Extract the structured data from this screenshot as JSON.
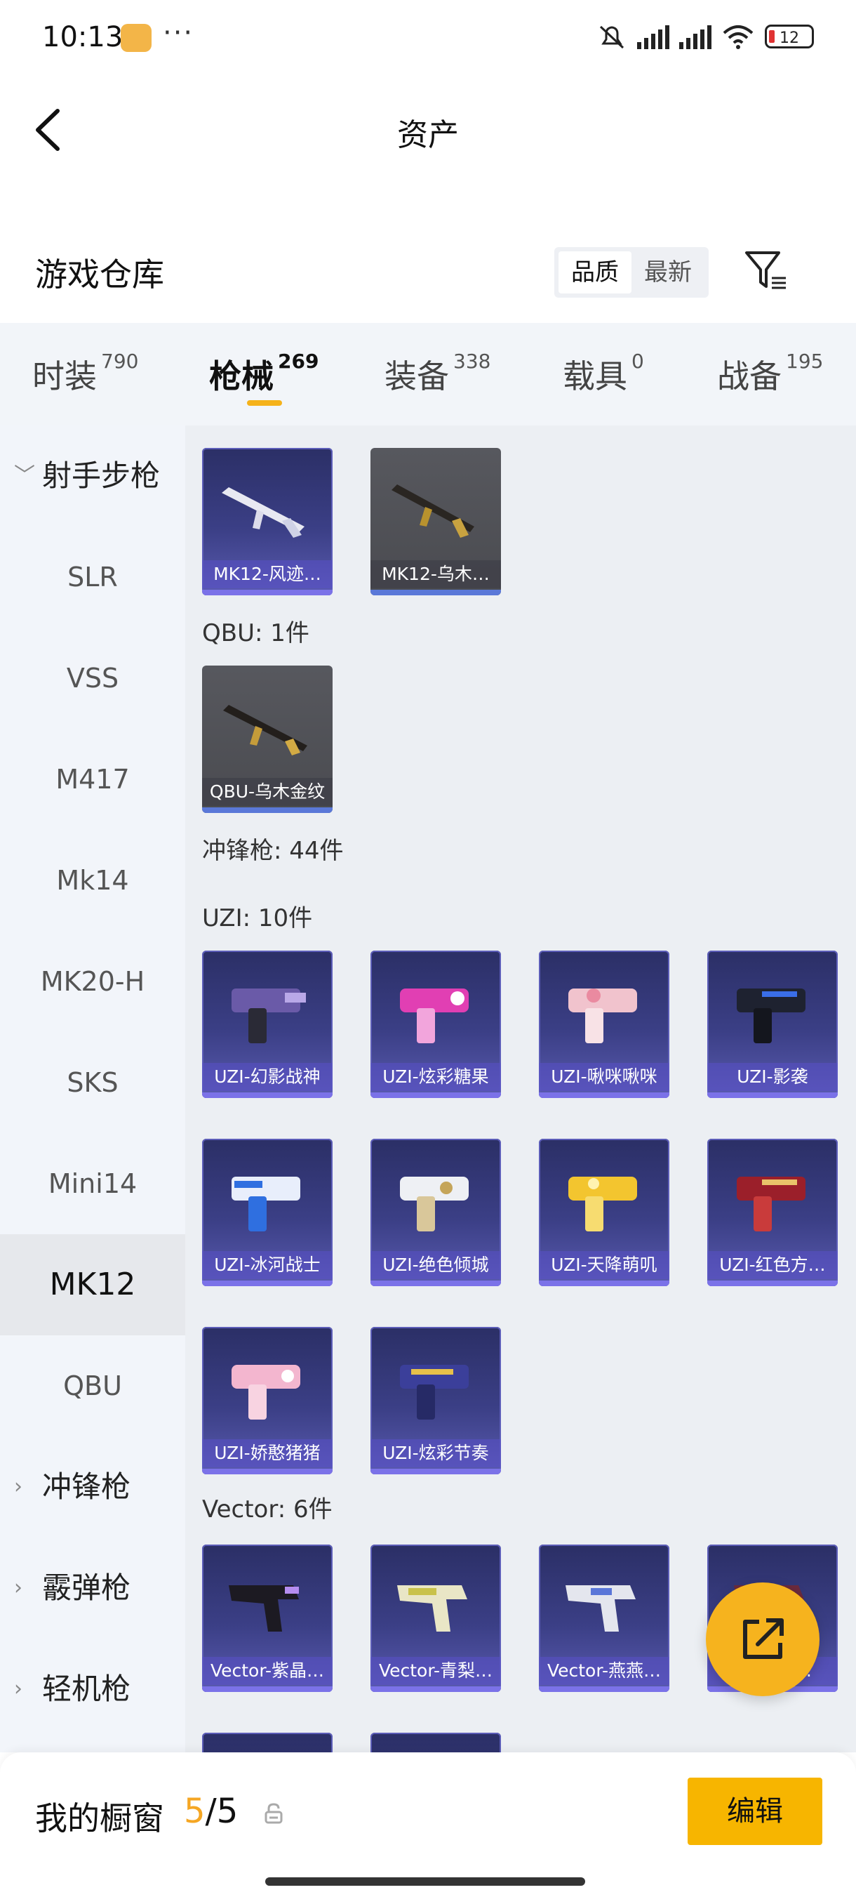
{
  "status_bar": {
    "time": "10:13",
    "dots": "···",
    "battery": "12",
    "icons": [
      "app-notification-icon",
      "mute-icon",
      "signal-hd-icon",
      "signal-hd-icon",
      "wifi-icon",
      "battery-icon"
    ]
  },
  "header": {
    "title": "资产",
    "back_icon": "back-arrow-icon"
  },
  "warehouse": {
    "title": "游戏仓库",
    "sort_options": [
      "品质",
      "最新"
    ],
    "active_sort": "品质",
    "filter_icon": "filter-icon"
  },
  "tabs": [
    {
      "label": "时装",
      "count": "790"
    },
    {
      "label": "枪械",
      "count": "269",
      "active": true
    },
    {
      "label": "装备",
      "count": "338"
    },
    {
      "label": "载具",
      "count": "0"
    },
    {
      "label": "战备",
      "count": "195"
    }
  ],
  "sidebar": {
    "items": [
      {
        "label": "射手步枪",
        "group": true,
        "expanded": true
      },
      {
        "label": "SLR"
      },
      {
        "label": "VSS"
      },
      {
        "label": "M417"
      },
      {
        "label": "Mk14"
      },
      {
        "label": "MK20-H"
      },
      {
        "label": "SKS"
      },
      {
        "label": "Mini14"
      },
      {
        "label": "MK12",
        "active": true
      },
      {
        "label": "QBU"
      },
      {
        "label": "冲锋枪",
        "group": true
      },
      {
        "label": "霰弹枪",
        "group": true
      },
      {
        "label": "轻机枪",
        "group": true
      }
    ]
  },
  "content": {
    "mk12_items": [
      "MK12-风迹…",
      "MK12-乌木…"
    ],
    "qbu_header": "QBU: 1件",
    "qbu_items": [
      "QBU-乌木金纹"
    ],
    "smg_header": "冲锋枪: 44件",
    "uzi_header": "UZI: 10件",
    "uzi_items": [
      "UZI-幻影战神",
      "UZI-炫彩糖果",
      "UZI-啾咪啾咪",
      "UZI-影袭",
      "UZI-冰河战士",
      "UZI-绝色倾城",
      "UZI-天降萌叽",
      "UZI-红色方…",
      "UZI-娇憨猪猪",
      "UZI-炫彩节奏"
    ],
    "vector_header": "Vector: 6件",
    "vector_items": [
      "Vector-紫晶…",
      "Vector-青梨…",
      "Vector-燕燕…",
      "Vector-…"
    ]
  },
  "fab": {
    "icon": "share-external-icon"
  },
  "bottom": {
    "title": "我的橱窗",
    "count_current": "5",
    "count_total": "/5",
    "lock_icon": "lock-icon",
    "edit_label": "编辑"
  },
  "colors": {
    "accent": "#f7b500",
    "card_purple": "#3b3f86",
    "card_grey": "#4f5055"
  }
}
